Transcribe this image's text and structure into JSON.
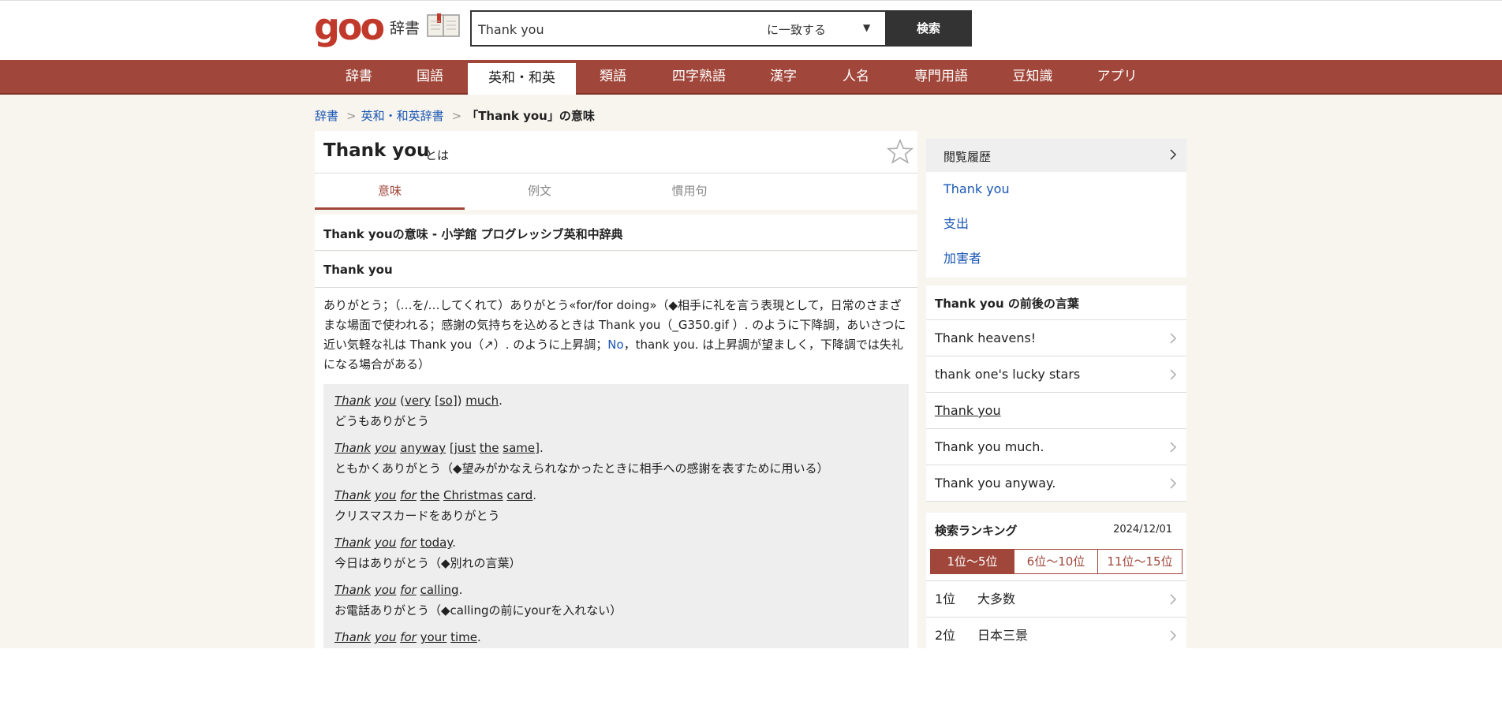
{
  "header": {
    "logo": "goo",
    "logo_sub": "辞書",
    "search_value": "Thank you",
    "search_mode": "に一致する",
    "search_caret": "▼",
    "search_button": "検索"
  },
  "nav": [
    "辞書",
    "国語",
    "英和・和英",
    "類語",
    "四字熟語",
    "漢字",
    "人名",
    "専門用語",
    "豆知識",
    "アプリ"
  ],
  "breadcrumb": {
    "home": "辞書",
    "sep": ">",
    "category": "英和・和英辞書",
    "current": "「Thank you」の意味"
  },
  "entry": {
    "title": "Thank you",
    "toha": "とは",
    "tabs": [
      "意味",
      "例文",
      "慣用句"
    ],
    "section_title": "Thank youの意味 - 小学館 プログレッシブ英和中辞典",
    "headword": "Thank you",
    "def_part1": "ありがとう；（…を/…してくれて）ありがとう«for/for doing»（◆相手に礼を言う表現として，日常のさまざまな場面で使われる；感謝の気持ちを込めるときは Thank you（_G350.gif ）. のように下降調，あいさつに近い気軽な礼は Thank you（↗）. のように上昇調；",
    "def_link": "No",
    "def_part2": "，thank you. は上昇調が望ましく，下降調では失礼になる場合がある）",
    "examples": [
      {
        "en": [
          "Thank",
          " ",
          "you",
          " (",
          "very",
          " [",
          "so",
          "]) ",
          "much",
          "."
        ],
        "ja": "どうもありがとう"
      },
      {
        "en": [
          "Thank",
          " ",
          "you",
          " ",
          "anyway",
          " [",
          "just",
          " ",
          "the",
          " ",
          "same",
          "]."
        ],
        "ja": "ともかくありがとう（◆望みがかなえられなかったときに相手への感謝を表すために用いる）"
      },
      {
        "en": [
          "Thank",
          " ",
          "you",
          " ",
          "for",
          " ",
          "the",
          " ",
          "Christmas",
          " ",
          "card",
          "."
        ],
        "ja": "クリスマスカードをありがとう"
      },
      {
        "en": [
          "Thank",
          " ",
          "you",
          " ",
          "for",
          " ",
          "today",
          "."
        ],
        "ja": "今日はありがとう（◆別れの言葉）"
      },
      {
        "en": [
          "Thank",
          " ",
          "you",
          " ",
          "for",
          " ",
          "calling",
          "."
        ],
        "ja": "お電話ありがとう（◆callingの前にyourを入れない）"
      },
      {
        "en": [
          "Thank",
          " ",
          "you",
          " ",
          "for",
          " ",
          "your",
          " ",
          "time",
          "."
        ],
        "ja": ""
      }
    ]
  },
  "sidebar": {
    "history_title": "閲覧履歴",
    "history": [
      "Thank you",
      "支出",
      "加害者"
    ],
    "around_title": "Thank you の前後の言葉",
    "around": [
      "Thank heavens!",
      "thank one's lucky stars",
      "Thank you",
      "Thank you much.",
      "Thank you anyway."
    ],
    "ranking_title": "検索ランキング",
    "ranking_date": "2024/12/01",
    "ranking_tabs": [
      "1位～5位",
      "6位～10位",
      "11位～15位"
    ],
    "ranking": [
      {
        "rank": "1位",
        "word": "大多数"
      },
      {
        "rank": "2位",
        "word": "日本三景"
      }
    ]
  },
  "colors": {
    "accent": "#a0463a",
    "link": "#1a56b4",
    "logo": "#c0392b"
  }
}
